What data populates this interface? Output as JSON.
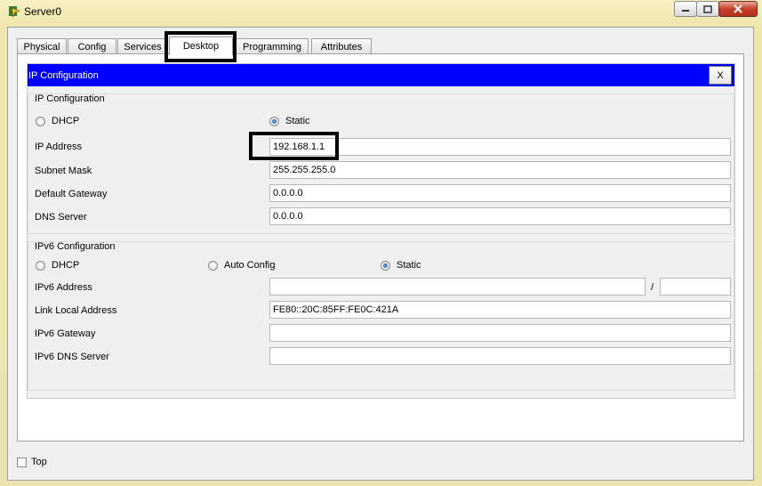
{
  "window": {
    "title": "Server0"
  },
  "tabs": [
    {
      "label": "Physical"
    },
    {
      "label": "Config"
    },
    {
      "label": "Services"
    },
    {
      "label": "Desktop"
    },
    {
      "label": "Programming"
    },
    {
      "label": "Attributes"
    }
  ],
  "active_tab": "Desktop",
  "dialog": {
    "title": "IP Configuration",
    "close_label": "X"
  },
  "ipv4": {
    "group_title": "IP Configuration",
    "dhcp_label": "DHCP",
    "static_label": "Static",
    "mode": "Static",
    "ip_label": "IP Address",
    "ip_value": "192.168.1.1",
    "mask_label": "Subnet Mask",
    "mask_value": "255.255.255.0",
    "gateway_label": "Default Gateway",
    "gateway_value": "0.0.0.0",
    "dns_label": "DNS Server",
    "dns_value": "0.0.0.0"
  },
  "ipv6": {
    "group_title": "IPv6 Configuration",
    "dhcp_label": "DHCP",
    "auto_label": "Auto Config",
    "static_label": "Static",
    "mode": "Static",
    "address_label": "IPv6 Address",
    "address_value": "",
    "prefix_separator": "/",
    "prefix_value": "",
    "link_local_label": "Link Local Address",
    "link_local_value": "FE80::20C:85FF:FE0C:421A",
    "gateway_label": "IPv6 Gateway",
    "gateway_value": "",
    "dns_label": "IPv6 DNS Server",
    "dns_value": ""
  },
  "footer": {
    "top_label": "Top",
    "top_checked": false
  },
  "colors": {
    "dialog_header": "#0000ff",
    "highlight_box": "#000000"
  }
}
